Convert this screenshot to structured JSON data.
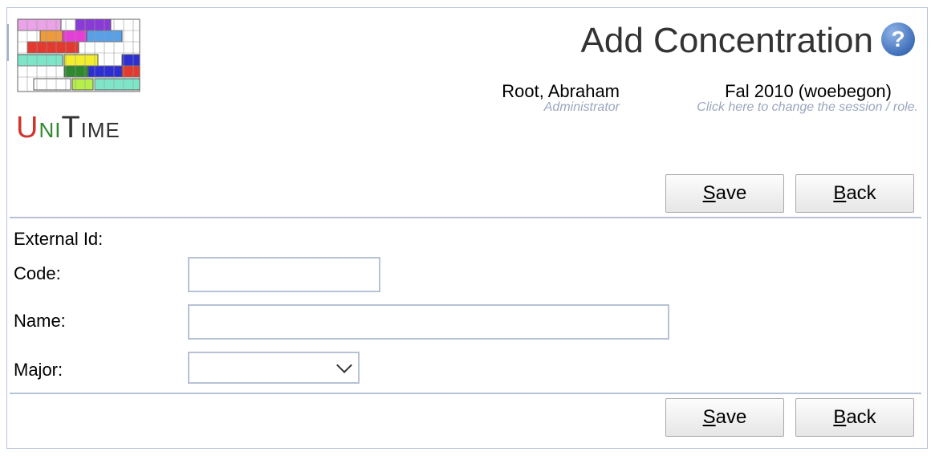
{
  "page_title": "Add Concentration",
  "help_glyph": "?",
  "logo": {
    "u": "U",
    "ni": "NI",
    "t": "T",
    "ime": "IME"
  },
  "user": {
    "name": "Root, Abraham",
    "role": "Administrator"
  },
  "session": {
    "name": "Fal 2010 (woebegon)",
    "hint": "Click here to change the session / role."
  },
  "buttons": {
    "save_first": "S",
    "save_rest": "ave",
    "back_first": "B",
    "back_rest": "ack"
  },
  "form": {
    "external_id_label": "External Id:",
    "code_label": "Code:",
    "name_label": "Name:",
    "major_label": "Major:",
    "code_value": "",
    "name_value": "",
    "major_value": ""
  },
  "icons": {
    "help": "help-icon",
    "dropdown": "chevron-down-icon"
  }
}
